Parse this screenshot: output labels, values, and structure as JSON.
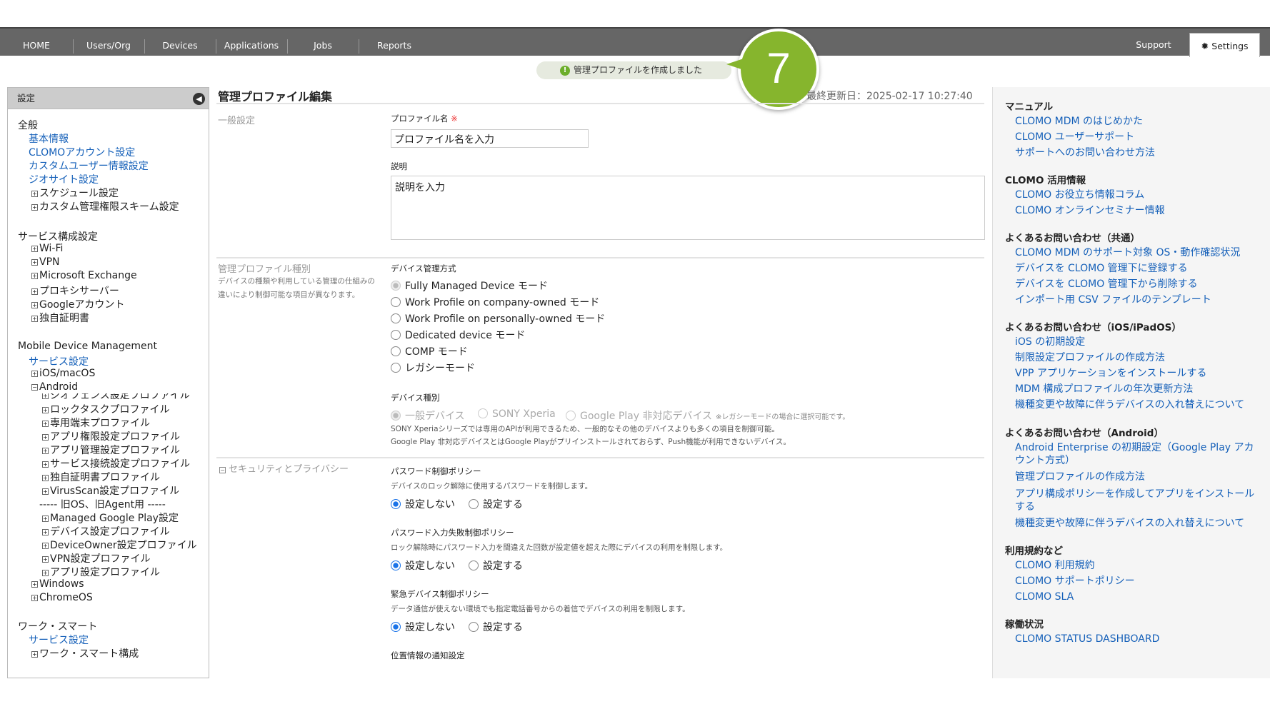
{
  "nav": {
    "items": [
      "HOME",
      "Users/Org",
      "Devices",
      "Applications",
      "Jobs",
      "Reports"
    ],
    "support": "Support",
    "settings": "Settings"
  },
  "toast": {
    "message": "管理プロファイルを作成しました"
  },
  "step_badge": "7",
  "sidebar": {
    "header": "設定",
    "sections": [
      {
        "title": "全般",
        "links": [
          "基本情報",
          "CLOMOアカウント設定",
          "カスタムユーザー情報設定",
          "ジオサイト設定"
        ],
        "expand": [
          "スケジュール設定",
          "カスタム管理権限スキーム設定"
        ]
      },
      {
        "title": "サービス構成設定",
        "expand": [
          "Wi-Fi",
          "VPN",
          "Microsoft Exchange",
          "プロキシサーバー",
          "Googleアカウント",
          "独自証明書"
        ]
      },
      {
        "title": "Mobile Device Management",
        "link": "サービス設定",
        "expand": [
          "iOS/macOS"
        ],
        "android": "Android",
        "android_items": [
          "ジオフェンス設定プロファイル",
          "ロックタスクプロファイル",
          "専用端末プロファイル",
          "アプリ権限設定プロファイル",
          "アプリ管理設定プロファイル",
          "サービス接続設定プロファイル",
          "独自証明書プロファイル",
          "VirusScan設定プロファイル"
        ],
        "divider": "----- 旧OS、旧Agent用 -----",
        "legacy_items": [
          "Managed Google Play設定",
          "デバイス設定プロファイル",
          "DeviceOwner設定プロファイル",
          "VPN設定プロファイル",
          "アプリ設定プロファイル"
        ],
        "more": [
          "Windows",
          "ChromeOS"
        ]
      },
      {
        "title": "ワーク・スマート",
        "link": "サービス設定",
        "expand": [
          "ワーク・スマート構成"
        ]
      }
    ]
  },
  "main": {
    "title": "管理プロファイル編集",
    "last_updated": "最終更新日：2025-02-17 10:27:40",
    "general": {
      "section": "一般設定",
      "name_label": "プロファイル名",
      "required": "※",
      "name_placeholder": "プロファイル名を入力",
      "desc_label": "説明",
      "desc_placeholder": "説明を入力"
    },
    "type": {
      "section": "管理プロファイル種別",
      "section_desc": "デバイスの種類や利用している管理の仕組みの違いにより制御可能な項目が異なります。",
      "mode_label": "デバイス管理方式",
      "modes": [
        "Fully Managed Device モード",
        "Work Profile on company-owned モード",
        "Work Profile on personally-owned モード",
        "Dedicated device モード",
        "COMP モード",
        "レガシーモード"
      ],
      "device_label": "デバイス種別",
      "devices": [
        "一般デバイス",
        "SONY Xperia",
        "Google Play 非対応デバイス"
      ],
      "device_note": "※レガシーモードの場合に選択可能です。",
      "note1": "SONY Xperiaシリーズでは専用のAPIが利用できるため、一般的なその他のデバイスよりも多くの項目を制御可能。",
      "note2": "Google Play 非対応デバイスとはGoogle Playがプリインストールされておらず、Push機能が利用できないデバイス。"
    },
    "security": {
      "section": "セキュリティとプライバシー",
      "policies": [
        {
          "title": "パスワード制御ポリシー",
          "desc": "デバイスのロック解除に使用するパスワードを制御します。",
          "off": "設定しない",
          "on": "設定する"
        },
        {
          "title": "パスワード入力失敗制御ポリシー",
          "desc": "ロック解除時にパスワード入力を間違えた回数が設定値を超えた際にデバイスの利用を制限します。",
          "off": "設定しない",
          "on": "設定する"
        },
        {
          "title": "緊急デバイス制御ポリシー",
          "desc": "データ通信が使えない環境でも指定電話番号からの着信でデバイスの利用を制限します。",
          "off": "設定しない",
          "on": "設定する"
        }
      ],
      "next_title": "位置情報の通知設定"
    }
  },
  "right": {
    "groups": [
      {
        "title": "マニュアル",
        "links": [
          "CLOMO MDM のはじめかた",
          "CLOMO ユーザーサポート",
          "サポートへのお問い合わせ方法"
        ]
      },
      {
        "title": "CLOMO 活用情報",
        "links": [
          "CLOMO お役立ち情報コラム",
          "CLOMO オンラインセミナー情報"
        ]
      },
      {
        "title": "よくあるお問い合わせ（共通）",
        "links": [
          "CLOMO MDM のサポート対象 OS・動作確認状況",
          "デバイスを CLOMO 管理下に登録する",
          "デバイスを CLOMO 管理下から削除する",
          "インポート用 CSV ファイルのテンプレート"
        ]
      },
      {
        "title": "よくあるお問い合わせ（iOS/iPadOS）",
        "links": [
          "iOS の初期設定",
          "制限設定プロファイルの作成方法",
          "VPP アプリケーションをインストールする",
          "MDM 構成プロファイルの年次更新方法",
          "機種変更や故障に伴うデバイスの入れ替えについて"
        ]
      },
      {
        "title": "よくあるお問い合わせ（Android）",
        "links": [
          "Android Enterprise の初期設定（Google Play アカウント方式）",
          "管理プロファイルの作成方法",
          "アプリ構成ポリシーを作成してアプリをインストールする",
          "機種変更や故障に伴うデバイスの入れ替えについて"
        ]
      },
      {
        "title": "利用規約など",
        "links": [
          "CLOMO 利用規約",
          "CLOMO サポートポリシー",
          "CLOMO SLA"
        ]
      },
      {
        "title": "稼働状況",
        "links": [
          "CLOMO STATUS DASHBOARD"
        ]
      }
    ]
  }
}
